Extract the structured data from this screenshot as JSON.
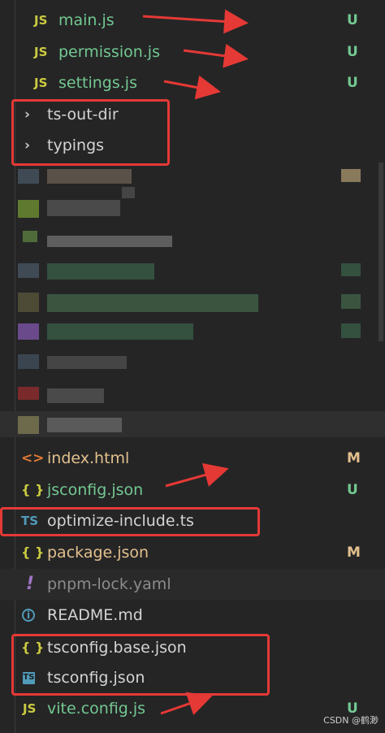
{
  "files_top": [
    {
      "label": "main.js",
      "icon": "js-icon",
      "badge": "U"
    },
    {
      "label": "permission.js",
      "icon": "js-icon",
      "badge": "U"
    },
    {
      "label": "settings.js",
      "icon": "js-icon",
      "badge": "U"
    }
  ],
  "folders": [
    {
      "label": "ts-out-dir",
      "icon": "chevron-right-icon"
    },
    {
      "label": "typings",
      "icon": "chevron-right-icon"
    }
  ],
  "files_bottom": [
    {
      "label": "index.html",
      "icon": "html-code-icon",
      "badge": "M"
    },
    {
      "label": "jsconfig.json",
      "icon": "json-braces-icon",
      "badge": "U"
    },
    {
      "label": "optimize-include.ts",
      "icon": "ts-icon",
      "badge": ""
    },
    {
      "label": "package.json",
      "icon": "json-braces-icon",
      "badge": "M"
    },
    {
      "label": "pnpm-lock.yaml",
      "icon": "yaml-exclamation-icon",
      "badge": ""
    },
    {
      "label": "README.md",
      "icon": "info-icon",
      "badge": ""
    },
    {
      "label": "tsconfig.base.json",
      "icon": "json-braces-icon",
      "badge": ""
    },
    {
      "label": "tsconfig.json",
      "icon": "ts-config-icon",
      "badge": ""
    },
    {
      "label": "vite.config.js",
      "icon": "js-icon",
      "badge": "U"
    }
  ],
  "icons_text": {
    "js": "JS",
    "json": "{ }",
    "html": "<>",
    "ts": "TS",
    "info": "i",
    "yaml": "!",
    "chevron": "›"
  },
  "watermark": "CSDN @鹤渺",
  "colors": {
    "background": "#252526",
    "untracked": "#73c991",
    "modified": "#e2c08d",
    "annotation": "#e53935"
  }
}
